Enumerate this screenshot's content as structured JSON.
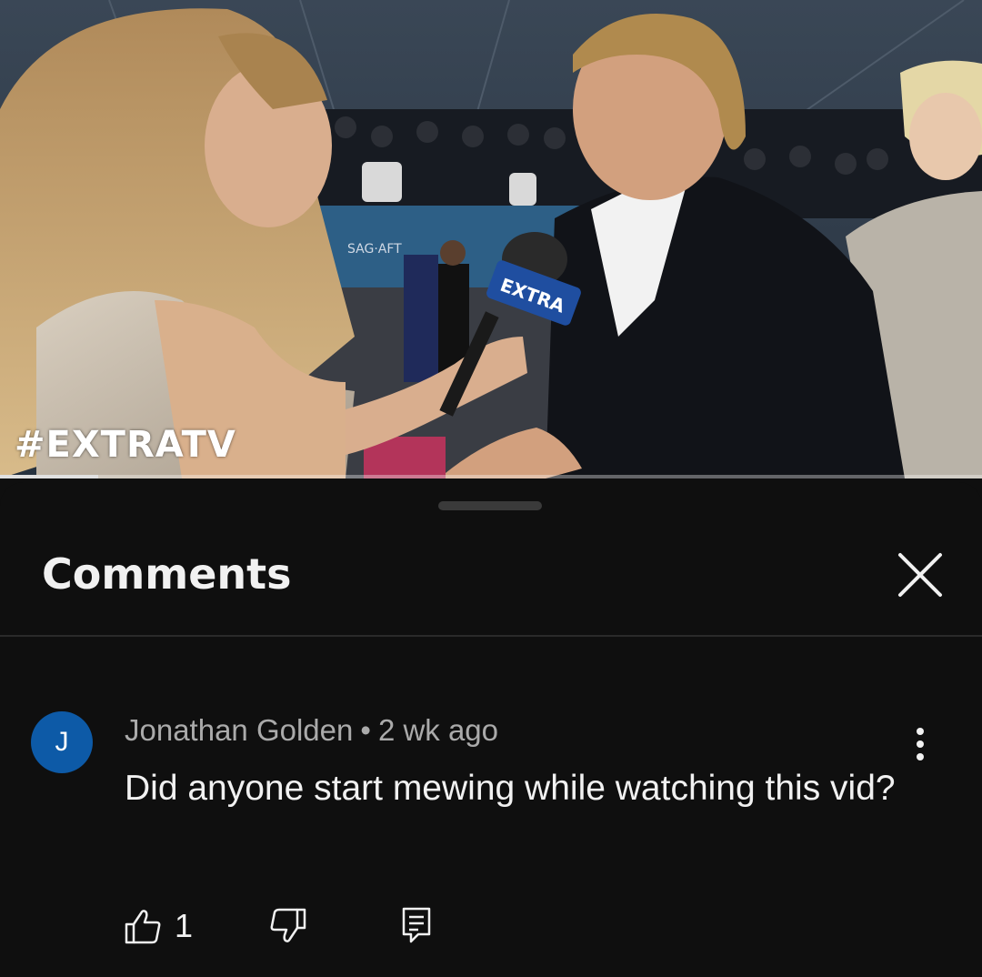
{
  "video": {
    "watermark": "#EXTRATV",
    "backdrop_text": "SAG·AFT",
    "mic_flag_text": "EXTRA",
    "progress_fraction": 0.1
  },
  "comments_panel": {
    "title": "Comments",
    "close_icon": "close-icon"
  },
  "comment": {
    "avatar_initial": "J",
    "avatar_color": "#0d5aa7",
    "author": "Jonathan Golden",
    "separator": "•",
    "time": "2 wk ago",
    "text": "Did anyone start mewing while watching this vid?",
    "like_count": "1",
    "icons": {
      "like": "thumbs-up-icon",
      "dislike": "thumbs-down-icon",
      "reply": "reply-icon",
      "more": "more-vertical-icon"
    }
  },
  "colors": {
    "background": "#0f0f0f",
    "text_primary": "#f1f1f1",
    "text_secondary": "#aaaaaa",
    "divider": "#2a2a2a"
  }
}
